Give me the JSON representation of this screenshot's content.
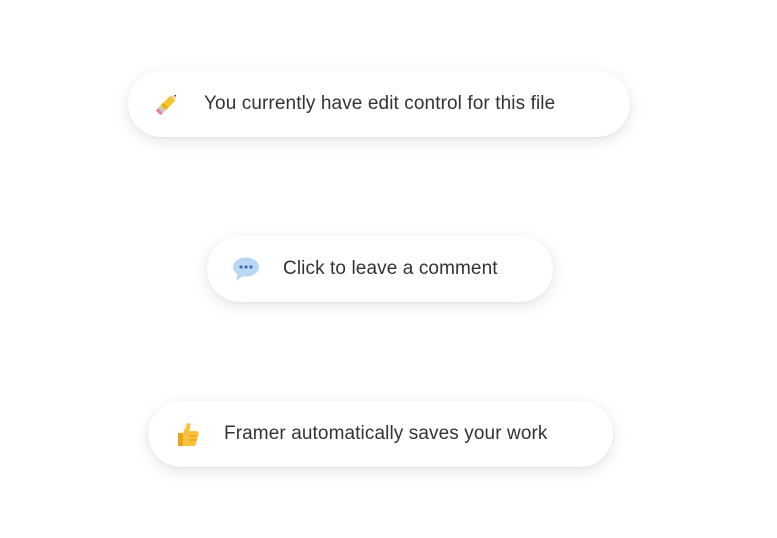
{
  "toasts": [
    {
      "icon": "pencil-icon",
      "text": "You currently have edit control for this file"
    },
    {
      "icon": "speech-bubble-icon",
      "text": "Click to leave a comment"
    },
    {
      "icon": "thumbs-up-icon",
      "text": "Framer automatically saves your work"
    }
  ]
}
